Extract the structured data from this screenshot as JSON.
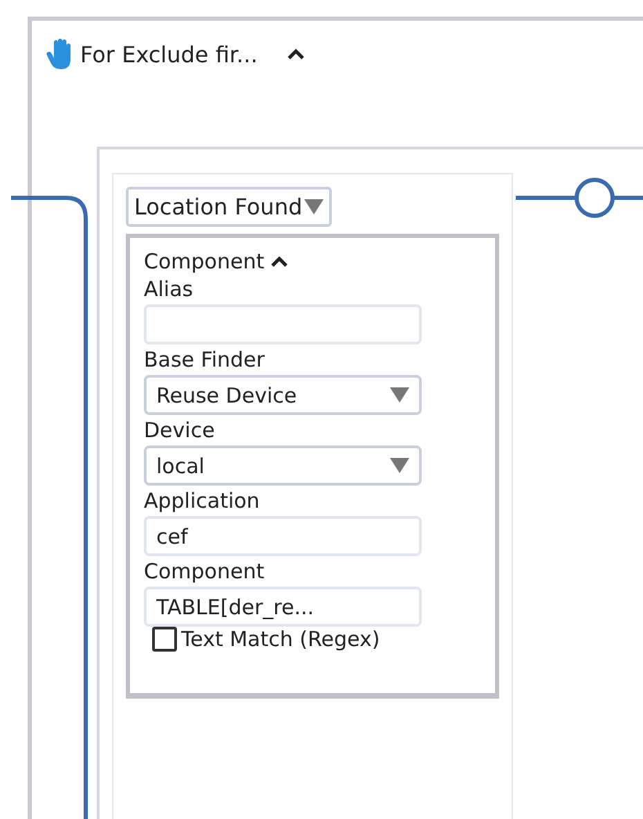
{
  "block": {
    "title": "For Exclude fir...",
    "expanded": true
  },
  "step": {
    "value": "Location Found"
  },
  "component": {
    "title": "Component",
    "expanded": true,
    "fields": [
      {
        "kind": "text",
        "label": "Alias"
      },
      {
        "kind": "select",
        "label": "Base Finder",
        "value": "Reuse Device"
      },
      {
        "kind": "select",
        "label": "Device",
        "value": "local"
      },
      {
        "kind": "text",
        "label": "Application",
        "value": "cef"
      },
      {
        "kind": "text",
        "label": "Component",
        "value": "TABLE[der_re..."
      }
    ],
    "option": {
      "label": "Text Match (Regex)",
      "checked": false
    }
  }
}
